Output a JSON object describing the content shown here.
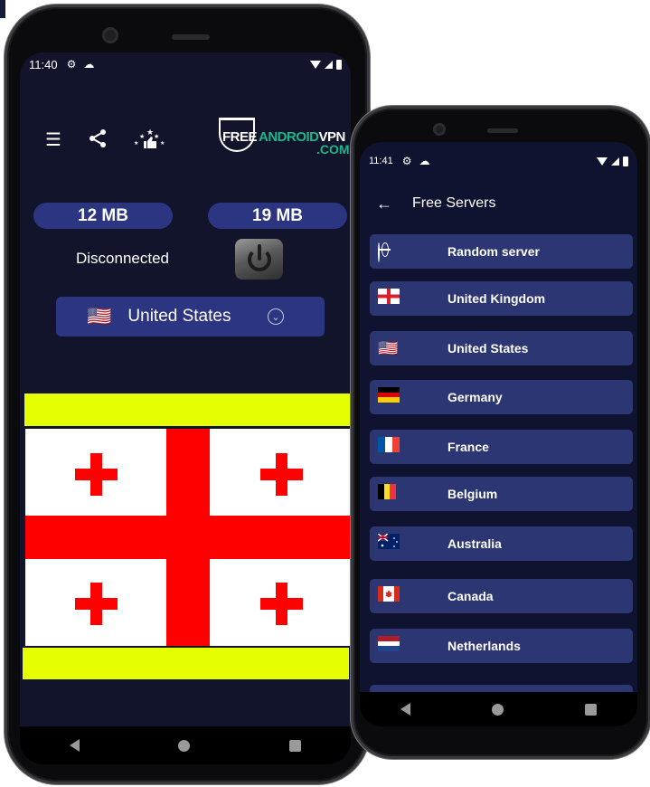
{
  "left_phone": {
    "status_bar": {
      "time": "11:40",
      "icons": [
        "gear-icon",
        "cloud-icon",
        "wifi-icon",
        "signal-icon",
        "battery-icon"
      ]
    },
    "toolbar": {
      "icons": [
        "list-icon",
        "share-icon",
        "rate-icon"
      ]
    },
    "logo": {
      "free": "FREE",
      "android": "ANDROID",
      "vpn": "VPN",
      "com": ".COM"
    },
    "traffic": {
      "download": "12 MB",
      "upload": "19 MB"
    },
    "connection_status": "Disconnected",
    "selected_country": {
      "flag": "🇺🇸",
      "name": "United States"
    },
    "ad": {
      "colors": {
        "banner": "#e6ff00",
        "cross": "#ff0000"
      }
    }
  },
  "right_phone": {
    "status_bar": {
      "time": "11:41",
      "icons": [
        "gear-icon",
        "cloud-icon",
        "wifi-icon",
        "signal-icon",
        "battery-icon"
      ]
    },
    "appbar": {
      "back": "←",
      "title": "Free Servers"
    },
    "servers": [
      {
        "flag": "globe",
        "name": "Random server"
      },
      {
        "flag": "🏴",
        "name": "United Kingdom"
      },
      {
        "flag": "🇺🇸",
        "name": "United States"
      },
      {
        "flag": "🇩🇪",
        "name": "Germany"
      },
      {
        "flag": "🇫🇷",
        "name": "France"
      },
      {
        "flag": "🇧🇪",
        "name": "Belgium"
      },
      {
        "flag": "🇦🇺",
        "name": "Australia"
      },
      {
        "flag": "🇨🇦",
        "name": "Canada"
      },
      {
        "flag": "🇳🇱",
        "name": "Netherlands"
      },
      {
        "flag": "",
        "name": ""
      }
    ]
  },
  "colors": {
    "screen_bg": "#11142a",
    "accent_blue": "#2b3582",
    "list_item": "#2b3672",
    "brand_green": "#1fb58a"
  }
}
